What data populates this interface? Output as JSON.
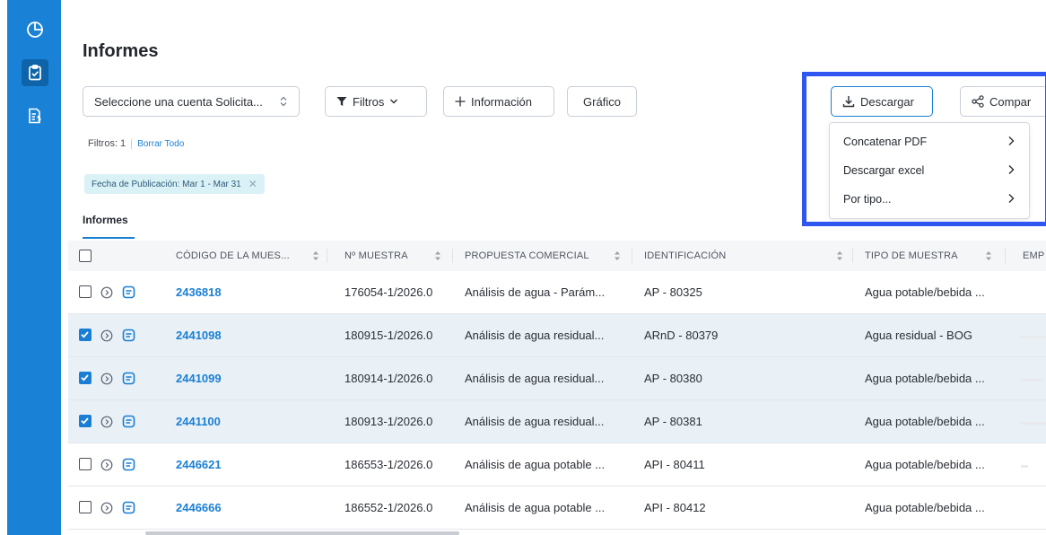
{
  "sidebar": {
    "icons": [
      "dashboard-icon",
      "clipboard-check-icon",
      "invoice-icon"
    ]
  },
  "page": {
    "title": "Informes"
  },
  "toolbar": {
    "account_select": "Seleccione una cuenta Solicita...",
    "filters_button": "Filtros",
    "info_button": "Información",
    "chart_button": "Gráfico",
    "download_button": "Descargar",
    "share_button": "Compar"
  },
  "filters": {
    "count_label": "Filtros: 1",
    "clear_all": "Borrar Todo",
    "chip": "Fecha de Publicación: Mar 1 - Mar 31"
  },
  "tabs": {
    "active": "Informes"
  },
  "table": {
    "columns": [
      "CÓDIGO DE LA MUES...",
      "Nº MUESTRA",
      "PROPUESTA COMERCIAL",
      "IDENTIFICACIÓN",
      "TIPO DE MUESTRA",
      "EMP"
    ],
    "rows": [
      {
        "checked": false,
        "code": "2436818",
        "sample": "176054-1/2026.0",
        "proposal": "Análisis de agua - Parám...",
        "id": "AP - 80325",
        "type": "Agua potable/bebida ..."
      },
      {
        "checked": true,
        "code": "2441098",
        "sample": "180915-1/2026.0",
        "proposal": "Análisis de agua residual...",
        "id": "ARnD - 80379",
        "type": "Agua residual - BOG"
      },
      {
        "checked": true,
        "code": "2441099",
        "sample": "180914-1/2026.0",
        "proposal": "Análisis de agua residual...",
        "id": "AP - 80380",
        "type": "Agua potable/bebida ..."
      },
      {
        "checked": true,
        "code": "2441100",
        "sample": "180913-1/2026.0",
        "proposal": "Análisis de agua residual...",
        "id": "AP - 80381",
        "type": "Agua potable/bebida ..."
      },
      {
        "checked": false,
        "code": "2446621",
        "sample": "186553-1/2026.0",
        "proposal": "Análisis de agua potable ...",
        "id": "API - 80411",
        "type": "Agua potable/bebida ..."
      },
      {
        "checked": false,
        "code": "2446666",
        "sample": "186552-1/2026.0",
        "proposal": "Análisis de agua potable ...",
        "id": "API - 80412",
        "type": "Agua potable/bebida ..."
      }
    ]
  },
  "download_menu": {
    "items": [
      "Concatenar PDF",
      "Descargar excel",
      "Por tipo..."
    ]
  },
  "colors": {
    "sidebar": "#1a82d6",
    "link": "#1a7fd4",
    "selected_row": "#e9f1f7",
    "highlight_box": "#2f56f0",
    "chip": "#daf2f5"
  }
}
